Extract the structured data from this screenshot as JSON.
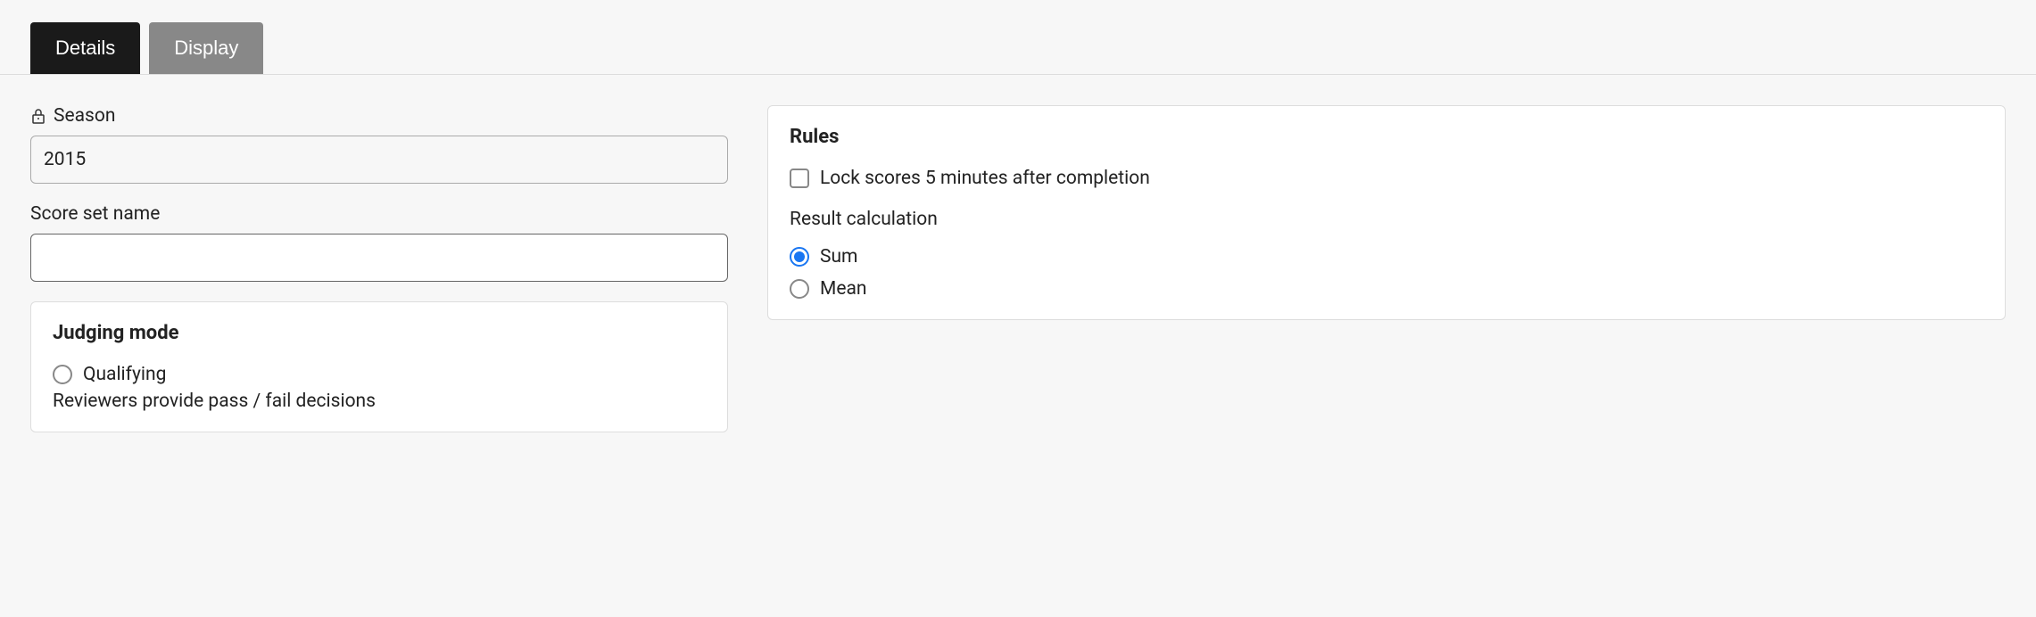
{
  "tabs": {
    "details": "Details",
    "display": "Display"
  },
  "fields": {
    "season": {
      "label": "Season",
      "value": "2015"
    },
    "score_set_name": {
      "label": "Score set name",
      "value": ""
    }
  },
  "judging": {
    "title": "Judging mode",
    "qualifying": {
      "label": "Qualifying",
      "description": "Reviewers provide pass / fail decisions"
    }
  },
  "rules": {
    "title": "Rules",
    "lock_scores": {
      "label": "Lock scores 5 minutes after completion"
    },
    "result_calc": {
      "label": "Result calculation",
      "sum": "Sum",
      "mean": "Mean"
    }
  }
}
